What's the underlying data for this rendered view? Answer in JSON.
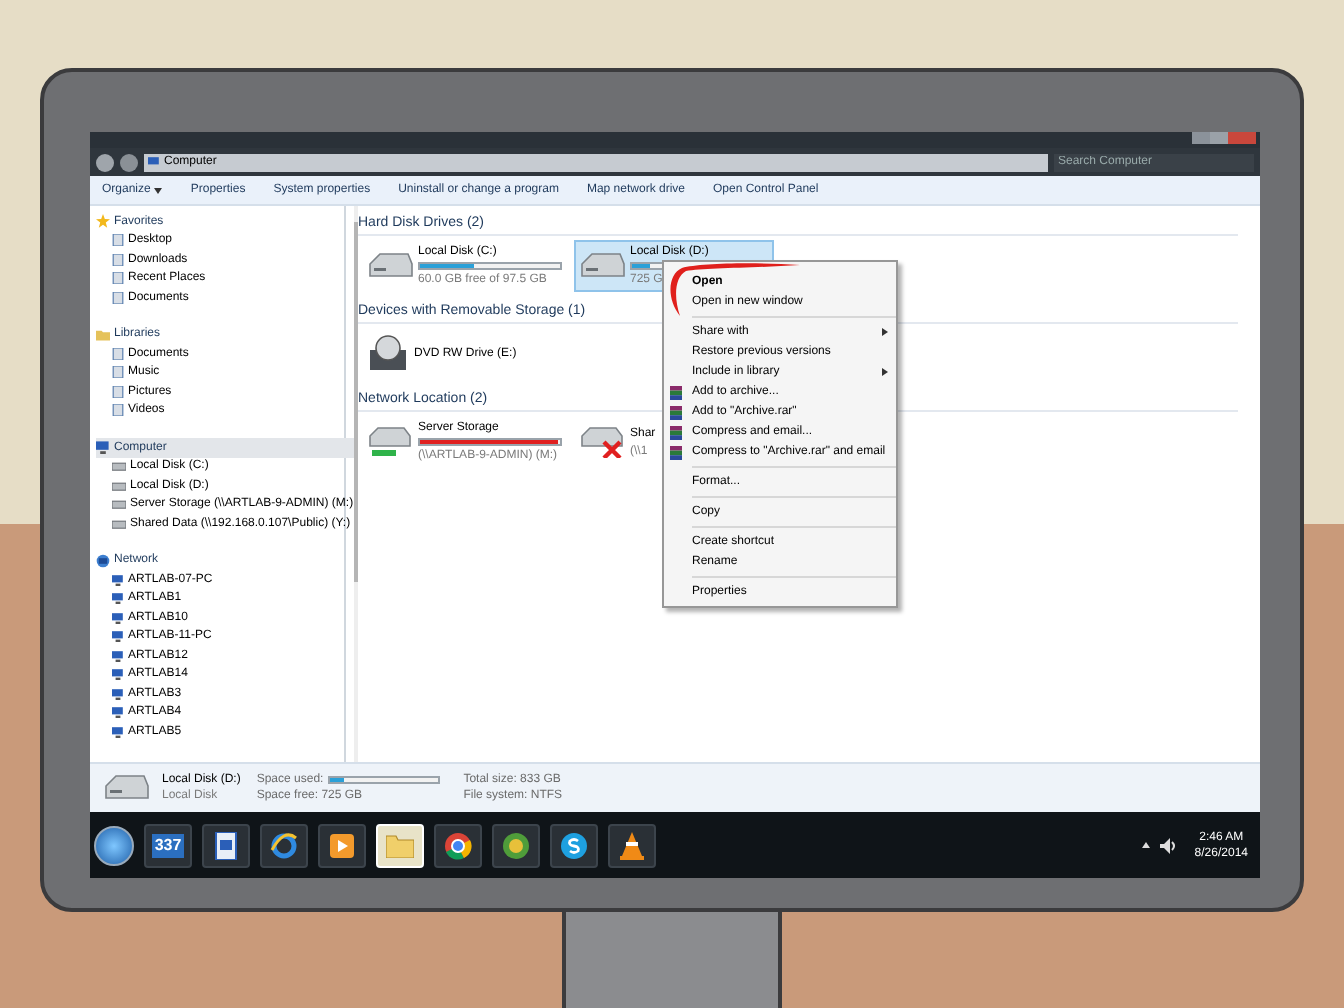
{
  "window": {
    "breadcrumb": "Computer",
    "search": {
      "placeholder": "Search Computer"
    }
  },
  "toolbar": [
    {
      "label": "Organize",
      "dropdown": true
    },
    {
      "label": "Properties",
      "dropdown": false
    },
    {
      "label": "System properties",
      "dropdown": false
    },
    {
      "label": "Uninstall or change a program",
      "dropdown": false
    },
    {
      "label": "Map network drive",
      "dropdown": false
    },
    {
      "label": "Open Control Panel",
      "dropdown": false
    }
  ],
  "sidebar": [
    {
      "label": "Favorites",
      "kind": "favorites",
      "selected": false,
      "children": [
        {
          "label": "Desktop"
        },
        {
          "label": "Downloads"
        },
        {
          "label": "Recent Places"
        },
        {
          "label": "Documents"
        }
      ]
    },
    {
      "label": "Libraries",
      "kind": "libraries",
      "selected": false,
      "children": [
        {
          "label": "Documents"
        },
        {
          "label": "Music"
        },
        {
          "label": "Pictures"
        },
        {
          "label": "Videos"
        }
      ]
    },
    {
      "label": "Computer",
      "kind": "computer",
      "selected": true,
      "children": [
        {
          "label": "Local Disk (C:)"
        },
        {
          "label": "Local Disk (D:)"
        },
        {
          "label": "Server Storage (\\\\ARTLAB-9-ADMIN) (M:)"
        },
        {
          "label": "Shared Data (\\\\192.168.0.107\\Public) (Y:)"
        }
      ]
    },
    {
      "label": "Network",
      "kind": "network",
      "selected": false,
      "children": [
        {
          "label": "ARTLAB-07-PC"
        },
        {
          "label": "ARTLAB1"
        },
        {
          "label": "ARTLAB10"
        },
        {
          "label": "ARTLAB-11-PC"
        },
        {
          "label": "ARTLAB12"
        },
        {
          "label": "ARTLAB14"
        },
        {
          "label": "ARTLAB3"
        },
        {
          "label": "ARTLAB4"
        },
        {
          "label": "ARTLAB5"
        }
      ]
    }
  ],
  "sections": [
    {
      "title": "Hard Disk Drives (2)",
      "items": [
        {
          "kind": "disk",
          "name": "Local Disk (C:)",
          "detail": "60.0 GB free of 97.5 GB",
          "level": 0.38,
          "color": "#2aa0d8",
          "selected": false
        },
        {
          "kind": "disk",
          "name": "Local Disk (D:)",
          "detail": "725 G",
          "level": 0.13,
          "color": "#2aa0d8",
          "selected": true
        }
      ]
    },
    {
      "title": "Devices with Removable Storage (1)",
      "items": [
        {
          "kind": "dvd",
          "name": "DVD RW Drive (E:)",
          "selected": false
        }
      ]
    },
    {
      "title": "Network Location (2)",
      "items": [
        {
          "kind": "network",
          "name": "Server Storage",
          "detail": "(\\\\ARTLAB-9-ADMIN) (M:)",
          "level": 0.99,
          "color": "#e02020",
          "selected": false,
          "connected": true
        },
        {
          "kind": "network",
          "name": "Shar",
          "detail": "(\\\\1",
          "selected": false,
          "connected": false
        }
      ]
    }
  ],
  "context_menu": [
    {
      "kind": "item",
      "label": "Open",
      "bold": true,
      "submenu": false,
      "archive": false
    },
    {
      "kind": "item",
      "label": "Open in new window",
      "bold": false,
      "submenu": false,
      "archive": false
    },
    {
      "kind": "separator"
    },
    {
      "kind": "item",
      "label": "Share with",
      "bold": false,
      "submenu": true,
      "archive": false
    },
    {
      "kind": "item",
      "label": "Restore previous versions",
      "bold": false,
      "submenu": false,
      "archive": false
    },
    {
      "kind": "item",
      "label": "Include in library",
      "bold": false,
      "submenu": true,
      "archive": false
    },
    {
      "kind": "item",
      "label": "Add to archive...",
      "bold": false,
      "submenu": false,
      "archive": true
    },
    {
      "kind": "item",
      "label": "Add to \"Archive.rar\"",
      "bold": false,
      "submenu": false,
      "archive": true
    },
    {
      "kind": "item",
      "label": "Compress and email...",
      "bold": false,
      "submenu": false,
      "archive": true
    },
    {
      "kind": "item",
      "label": "Compress to \"Archive.rar\" and email",
      "bold": false,
      "submenu": false,
      "archive": true
    },
    {
      "kind": "separator"
    },
    {
      "kind": "item",
      "label": "Format...",
      "bold": false,
      "submenu": false,
      "archive": false
    },
    {
      "kind": "separator"
    },
    {
      "kind": "item",
      "label": "Copy",
      "bold": false,
      "submenu": false,
      "archive": false
    },
    {
      "kind": "separator"
    },
    {
      "kind": "item",
      "label": "Create shortcut",
      "bold": false,
      "submenu": false,
      "archive": false
    },
    {
      "kind": "item",
      "label": "Rename",
      "bold": false,
      "submenu": false,
      "archive": false
    },
    {
      "kind": "separator"
    },
    {
      "kind": "item",
      "label": "Properties",
      "bold": false,
      "submenu": false,
      "archive": false
    }
  ],
  "details": {
    "name": "Local Disk (D:)",
    "type": "Local Disk",
    "used_label": "Space used:",
    "level": 0.13,
    "free": "Space free: 725 GB",
    "total": "Total size: 833 GB",
    "filesystem": "File system: NTFS"
  },
  "taskbar": {
    "apps": [
      {
        "kind": "calendar",
        "label": "337",
        "selected": false
      },
      {
        "kind": "document",
        "selected": false
      },
      {
        "kind": "browser",
        "selected": false
      },
      {
        "kind": "media",
        "selected": false
      },
      {
        "kind": "folder",
        "selected": true
      },
      {
        "kind": "chrome",
        "selected": false
      },
      {
        "kind": "game",
        "selected": false
      },
      {
        "kind": "chat",
        "selected": false
      },
      {
        "kind": "cone",
        "selected": false
      }
    ],
    "time": "2:46 AM",
    "date": "8/26/2014"
  }
}
